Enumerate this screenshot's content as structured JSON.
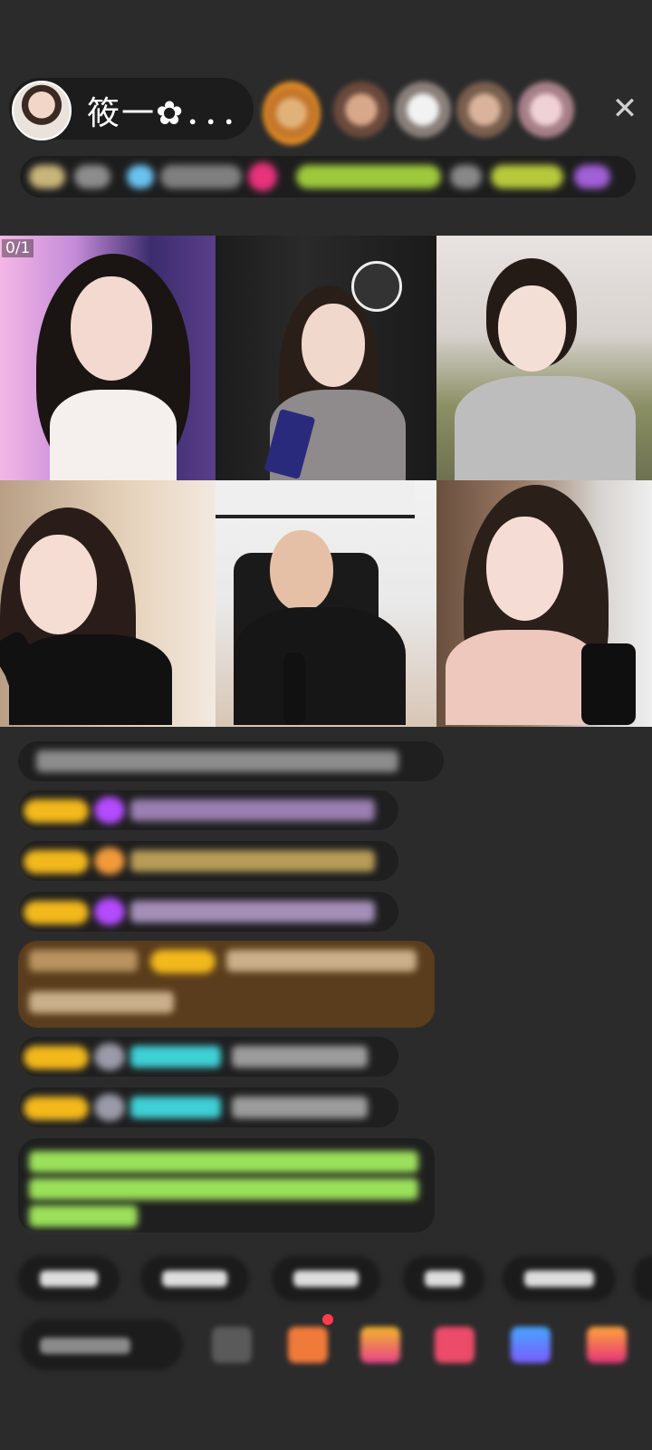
{
  "header": {
    "host_name": "筱一✿．．．",
    "close_symbol": "✕"
  },
  "grid": {
    "page_counter": "0/1"
  },
  "colors": {
    "background": "#2b2b2c",
    "badge_yellow": "#f2b81c",
    "gift_purple": "#b44bff",
    "chat_green": "#9be05a",
    "chat_teal": "#3fd0d5",
    "highlight_brown": "#5a3d1c"
  },
  "icons": {
    "close": "close-icon",
    "emoji": "emoji-icon",
    "gift_box": "gift-box-icon"
  }
}
